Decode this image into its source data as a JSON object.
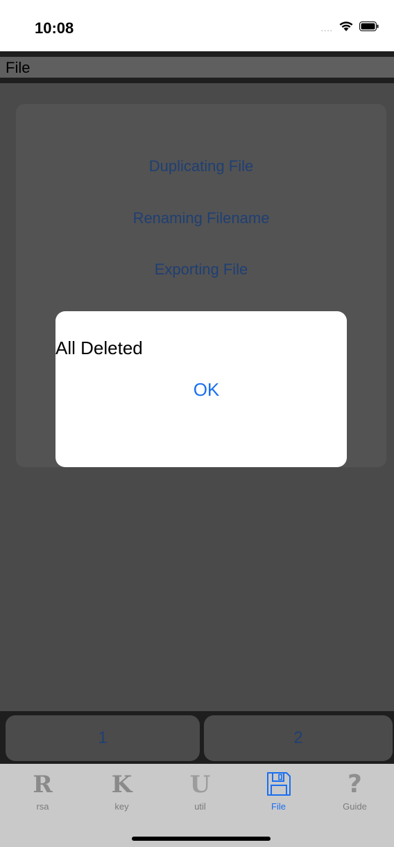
{
  "status_bar": {
    "time": "10:08",
    "signal": "....",
    "wifi_icon": "wifi-icon",
    "battery_icon": "battery-icon"
  },
  "header": {
    "title": "File"
  },
  "menu": {
    "items": [
      "Duplicating File",
      "Renaming Filename",
      "Exporting File"
    ]
  },
  "alert": {
    "message": "All Deleted",
    "ok_label": "OK"
  },
  "pages": {
    "buttons": [
      "1",
      "2"
    ]
  },
  "tabs": [
    {
      "glyph": "R",
      "label": "rsa",
      "icon": "r-icon"
    },
    {
      "glyph": "K",
      "label": "key",
      "icon": "k-icon"
    },
    {
      "glyph": "U",
      "label": "util",
      "icon": "u-icon"
    },
    {
      "glyph": "",
      "label": "File",
      "icon": "floppy-disk-icon",
      "active": true
    },
    {
      "glyph": "?",
      "label": "Guide",
      "icon": "question-mark-icon"
    }
  ],
  "colors": {
    "accent": "#1a6ff0",
    "link_dark": "#1f3f73",
    "background": "#4a4a4a",
    "tab_bar": "#c9c9c9"
  }
}
